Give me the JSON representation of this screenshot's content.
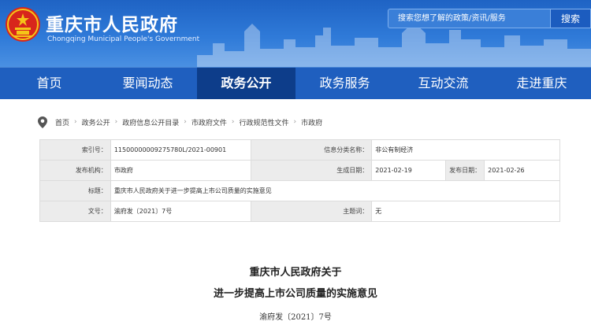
{
  "header": {
    "site_title": "重庆市人民政府",
    "site_subtitle": "Chongqing Municipal People's Government",
    "search_placeholder": "搜索您想了解的政策/资讯/服务",
    "search_button": "搜索"
  },
  "nav": {
    "items": [
      {
        "label": "首页"
      },
      {
        "label": "要闻动态"
      },
      {
        "label": "政务公开"
      },
      {
        "label": "政务服务"
      },
      {
        "label": "互动交流"
      },
      {
        "label": "走进重庆"
      }
    ],
    "active": "政务公开"
  },
  "breadcrumb": {
    "items": [
      "首页",
      "政务公开",
      "政府信息公开目录",
      "市政府文件",
      "行政规范性文件",
      "市政府"
    ],
    "separator": "›"
  },
  "info": {
    "index_label": "索引号：",
    "index_value": "11500000009275780L/2021-00901",
    "category_label": "信息分类名称：",
    "category_value": "非公有制经济",
    "issuer_label": "发布机构：",
    "issuer_value": "市政府",
    "created_label": "生成日期：",
    "created_value": "2021-02-19",
    "published_label": "发布日期：",
    "published_value": "2021-02-26",
    "title_label": "标题：",
    "title_value": "重庆市人民政府关于进一步提高上市公司质量的实施意见",
    "docno_label": "文号：",
    "docno_value": "渝府发〔2021〕7号",
    "subject_label": "主题词：",
    "subject_value": "无"
  },
  "document": {
    "title_line1": "重庆市人民政府关于",
    "title_line2": "进一步提高上市公司质量的实施意见",
    "doc_number": "渝府发〔2021〕7号"
  },
  "colors": {
    "header_blue": "#2f7ad8",
    "nav_blue": "#1f5fbf",
    "nav_active": "#0d3d8a",
    "emblem_red": "#d8261c",
    "emblem_gold": "#f5c518"
  }
}
